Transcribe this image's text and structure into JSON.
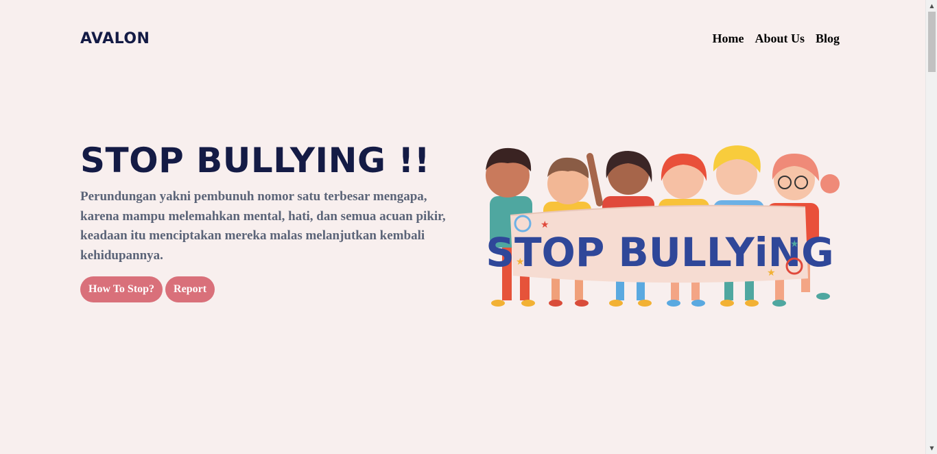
{
  "header": {
    "brand": "AVALON",
    "nav": [
      {
        "label": "Home"
      },
      {
        "label": "About Us"
      },
      {
        "label": "Blog"
      }
    ]
  },
  "hero": {
    "title": "STOP BULLYING !!",
    "description": "Perundungan yakni pembunuh nomor satu terbesar mengapa, karena mampu melemahkan mental, hati, dan semua acuan pikir, keadaan itu menciptakan mereka malas melanjutkan kembali kehidupannya.",
    "buttons": {
      "how_to_stop": "How To Stop?",
      "report": "Report"
    },
    "illustration": {
      "banner_text": "STOP BULLYiNG",
      "colors": {
        "banner": "#f6dcd2",
        "text": "#2f4799",
        "accent": "#d9707a"
      }
    }
  },
  "theme": {
    "background": "#f8efee",
    "heading": "#141b45",
    "body_text": "#5b6478",
    "button": "#d9707a"
  },
  "scrollbar": {
    "up_icon": "arrow-up-icon",
    "down_icon": "arrow-down-icon"
  }
}
